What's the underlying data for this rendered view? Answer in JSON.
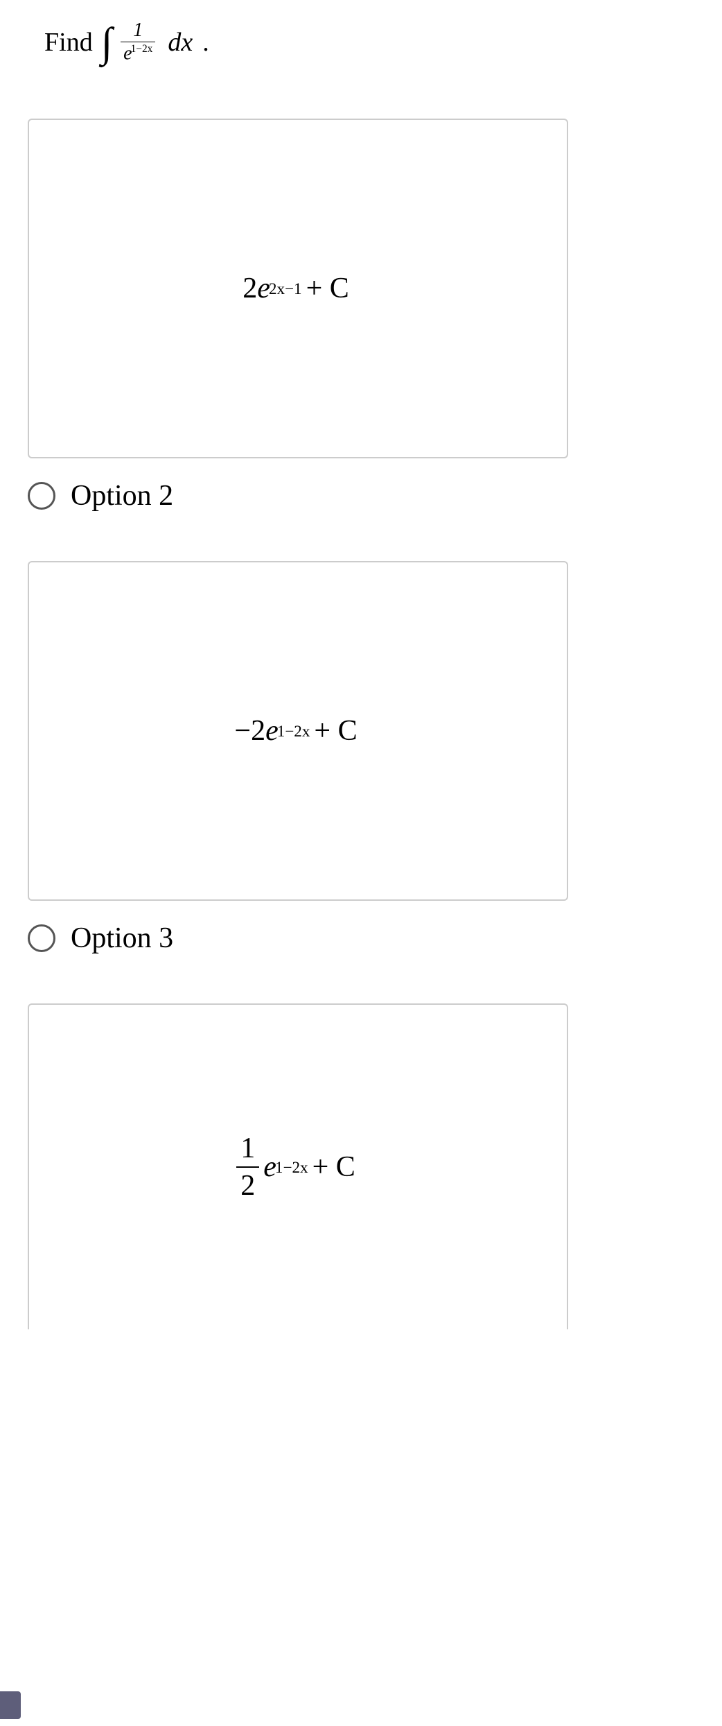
{
  "question": {
    "prompt": "Find",
    "integral_num": "1",
    "integral_den_base": "e",
    "integral_den_exp": "1−2x",
    "dx": "dx",
    "period": "."
  },
  "options": [
    {
      "label": "Option 2",
      "expr": {
        "lead": "2",
        "base": "e",
        "exp": "2x−1",
        "tail": "+ C"
      }
    },
    {
      "label": "Option 3",
      "expr": {
        "lead": "−2",
        "base": "e",
        "exp": "1−2x",
        "tail": "+ C"
      }
    },
    {
      "label": "",
      "expr": {
        "frac_num": "1",
        "frac_den": "2",
        "base": "e",
        "exp": "1−2x",
        "tail": "+ C"
      }
    }
  ]
}
